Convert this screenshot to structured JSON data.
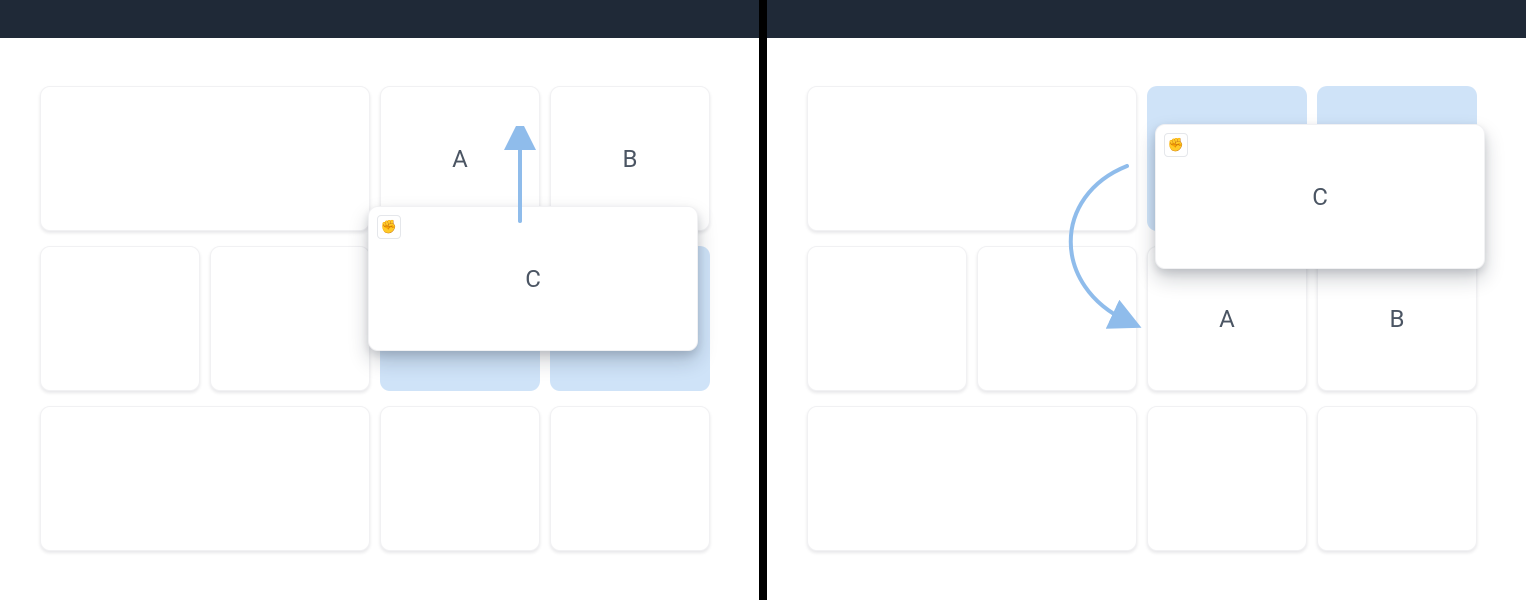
{
  "arrow_color": "#8fbceb",
  "left": {
    "cards": {
      "A": "A",
      "B": "B"
    },
    "dragged": {
      "label": "C",
      "handle_glyph": "✊"
    },
    "desc": "Dragging card C upward over cards A and B; target row below is highlighted"
  },
  "right": {
    "cards": {
      "A": "A",
      "B": "B"
    },
    "dragged": {
      "label": "C",
      "handle_glyph": "✊"
    },
    "desc": "After swap: C is in the top row (dragged), A and B shifted down; top-row placeholders highlighted"
  }
}
